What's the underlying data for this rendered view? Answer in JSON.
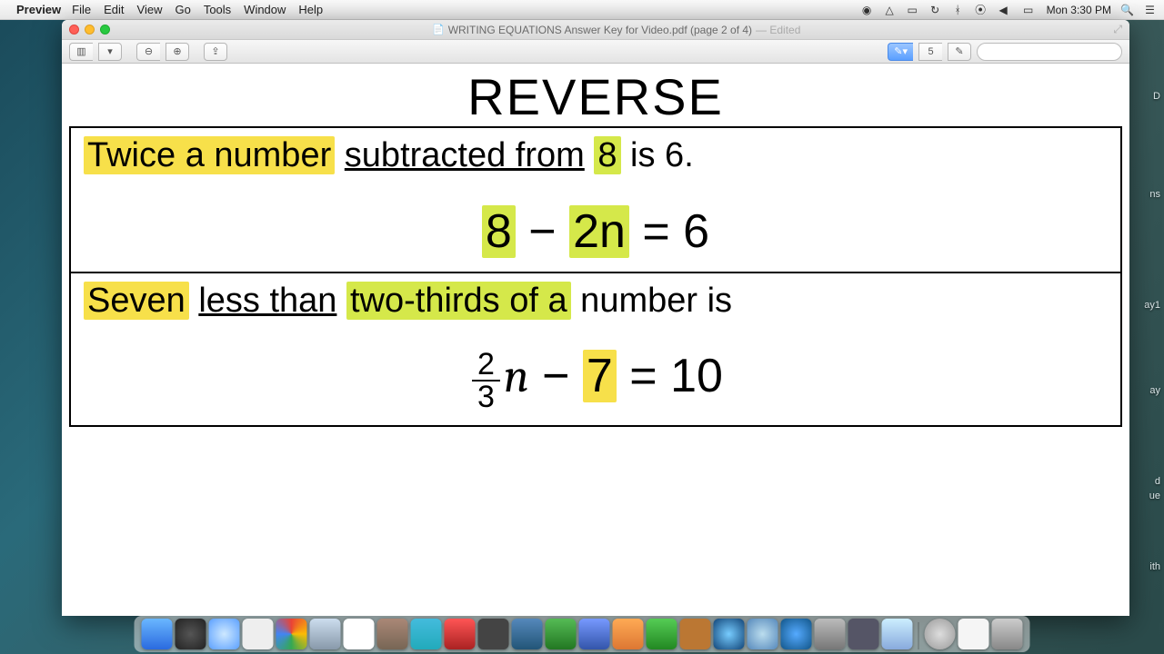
{
  "menubar": {
    "app": "Preview",
    "items": [
      "File",
      "Edit",
      "View",
      "Go",
      "Tools",
      "Window",
      "Help"
    ],
    "clock": "Mon 3:30 PM"
  },
  "window": {
    "title": "WRITING  EQUATIONS Answer Key for Video.pdf (page 2 of 4)",
    "edited": "— Edited",
    "toolbar": {
      "markup_page": "5",
      "search_placeholder": ""
    }
  },
  "document": {
    "heading": "REVERSE",
    "problems": [
      {
        "sentence": {
          "parts": [
            {
              "text": "Twice a number",
              "style": "hl"
            },
            {
              "text": " "
            },
            {
              "text": "subtracted from",
              "style": "ul"
            },
            {
              "text": " "
            },
            {
              "text": "8",
              "style": "hl-g"
            },
            {
              "text": " is 6."
            }
          ]
        },
        "equation": {
          "parts": [
            {
              "text": "8",
              "style": "hl-g"
            },
            {
              "text": " − "
            },
            {
              "text": "2n",
              "style": "hl-g"
            },
            {
              "text": " = 6"
            }
          ]
        }
      },
      {
        "sentence": {
          "parts": [
            {
              "text": "Seven",
              "style": "hl"
            },
            {
              "text": " "
            },
            {
              "text": "less than",
              "style": "ul"
            },
            {
              "text": " "
            },
            {
              "text": "two-thirds of a",
              "style": "hl-g"
            },
            {
              "text": " number is"
            }
          ]
        },
        "equation": {
          "frac": {
            "num": "2",
            "den": "3"
          },
          "after_frac": "n",
          "parts": [
            {
              "text": " − "
            },
            {
              "text": "7",
              "style": "hl"
            },
            {
              "text": " = 10"
            }
          ]
        }
      }
    ]
  },
  "desktop_peek": [
    "D",
    "ns",
    "ay1",
    "ay",
    "d",
    "ue",
    "ith"
  ]
}
